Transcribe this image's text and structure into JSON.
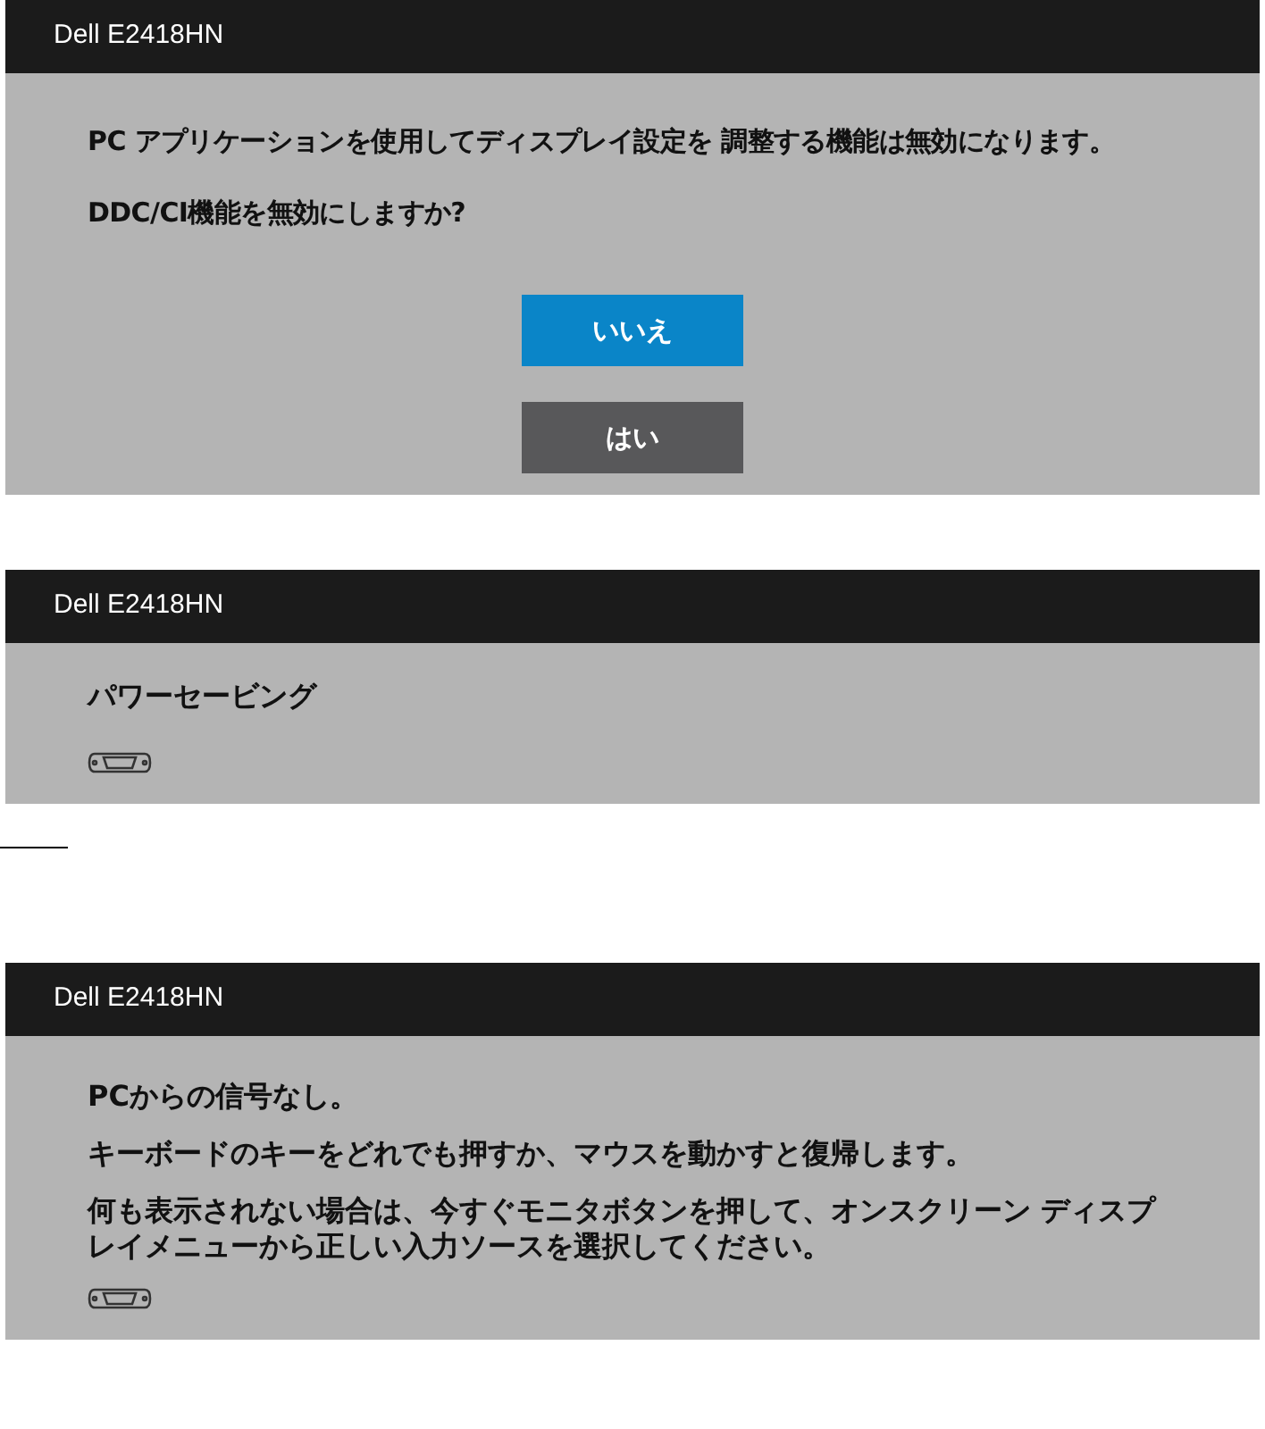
{
  "panels": [
    {
      "title": "Dell E2418HN",
      "messages": [
        "PC アプリケーションを使用してディスプレイ設定を 調整する機能は無効になります。",
        "DDC/CI機能を無効にしますか?"
      ],
      "buttons": [
        {
          "label": "いいえ",
          "selected": true
        },
        {
          "label": "はい",
          "selected": false
        }
      ],
      "connector_icon": false
    },
    {
      "title": "Dell E2418HN",
      "messages": [
        "パワーセービング"
      ],
      "connector_icon": true
    },
    {
      "title": "Dell E2418HN",
      "messages": [
        "PCからの信号なし。",
        "キーボードのキーをどれでも押すか、マウスを動かすと復帰します。",
        "何も表示されない場合は、今すぐモニタボタンを押して、オンスクリーン ディスプレイメニューから正しい入力ソースを選択してください。"
      ],
      "connector_icon": true
    }
  ]
}
